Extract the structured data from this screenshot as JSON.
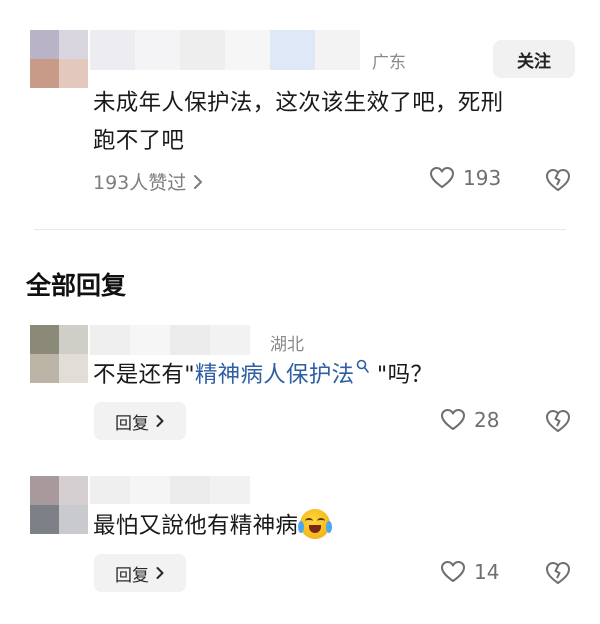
{
  "comment": {
    "location": "广东",
    "follow_label": "关注",
    "text_line1": "未成年人保护法，这次该生效了吧，死刑",
    "text_line2": "跑不了吧",
    "likes_summary": "193人赞过",
    "like_count": "193"
  },
  "replies_section": {
    "title": "全部回复"
  },
  "replies": [
    {
      "location": "湖北",
      "text_before": "不是还有\"",
      "link_text": "精神病人保护法",
      "text_after": " \"吗？",
      "reply_label": "回复",
      "like_count": "28"
    },
    {
      "text": "最怕又說他有精神病",
      "emoji": "crying-laughing-face",
      "reply_label": "回复",
      "like_count": "14"
    }
  ],
  "icons": {
    "like": "heart-outline-icon",
    "dislike": "broken-heart-icon",
    "search": "search-icon",
    "chevron": "chevron-right-icon"
  },
  "colors": {
    "link": "#2f5fa3",
    "muted": "#7d7d7d"
  }
}
